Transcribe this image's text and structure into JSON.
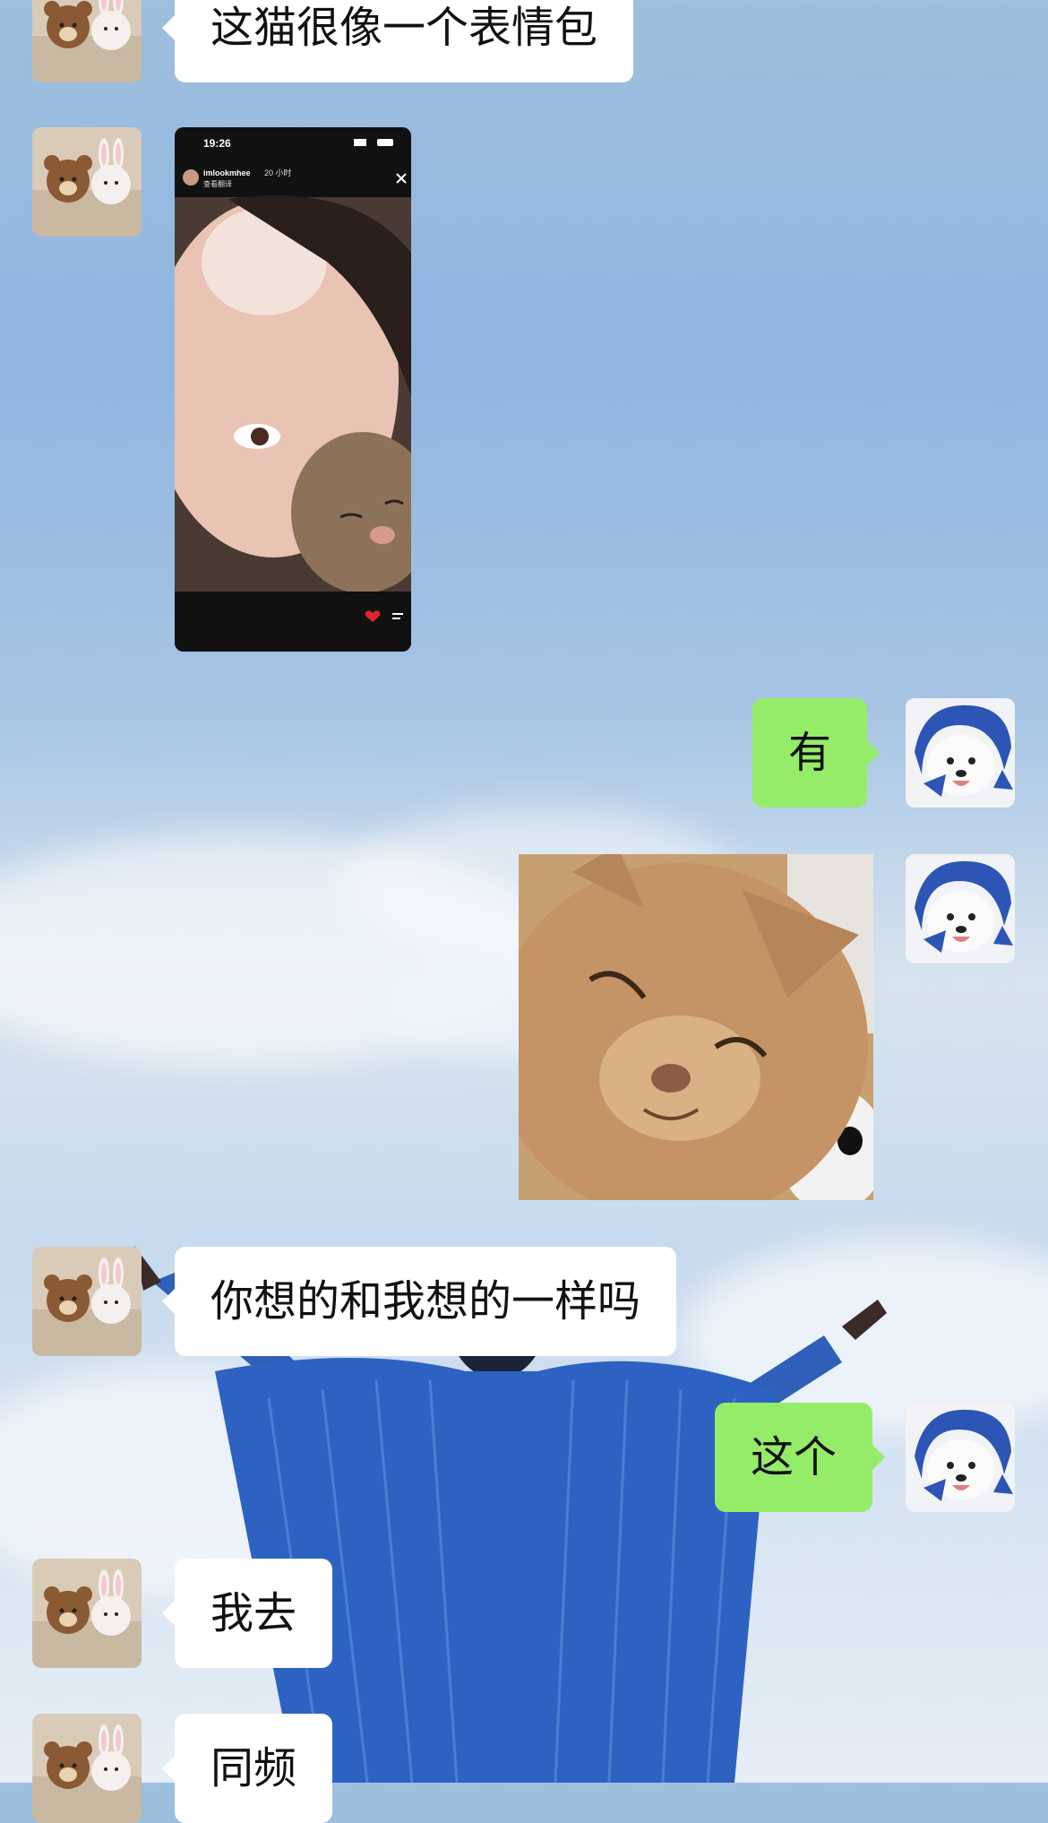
{
  "messages": [
    {
      "side": "left",
      "type": "text",
      "text": "这猫很像一个表情包"
    },
    {
      "side": "left",
      "type": "image",
      "image": "phone-screenshot-cat",
      "status_time": "19:26",
      "username": "imlookmhee",
      "time_ago": "20 小时",
      "sub_line": "查看翻译"
    },
    {
      "side": "right",
      "type": "text",
      "text": "有"
    },
    {
      "side": "right",
      "type": "image",
      "image": "smiling-cat-sticker"
    },
    {
      "side": "left",
      "type": "text",
      "text": "你想的和我想的一样吗"
    },
    {
      "side": "right",
      "type": "text",
      "text": "这个"
    },
    {
      "side": "left",
      "type": "text",
      "text": "我去"
    },
    {
      "side": "left",
      "type": "text",
      "text": "同频"
    }
  ],
  "avatars": {
    "left": "bear-and-bunny-plush-avatar",
    "right": "samoyed-in-blue-hat-avatar"
  },
  "colors": {
    "incoming_bubble": "#ffffff",
    "outgoing_bubble": "#95ec69",
    "text": "#111111"
  }
}
